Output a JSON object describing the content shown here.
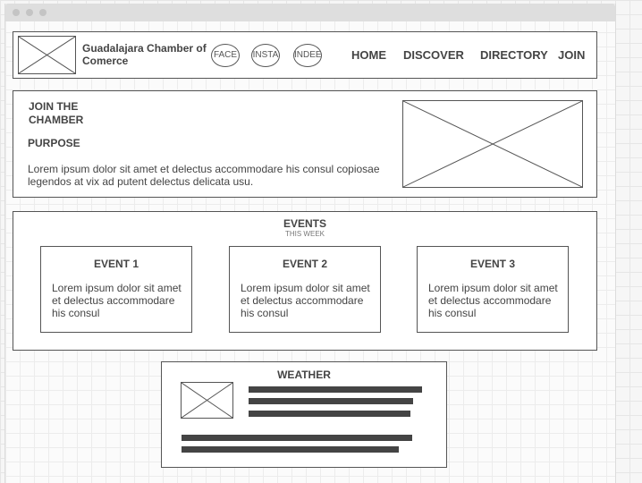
{
  "header": {
    "brand": "Guadalajara Chamber of Comerce",
    "social": [
      "FACE",
      "INSTA",
      "INDEE"
    ],
    "nav": [
      "HOME",
      "DISCOVER",
      "DIRECTORY",
      "JOIN"
    ]
  },
  "hero": {
    "title": "JOIN THE CHAMBER",
    "subtitle": "PURPOSE",
    "text": "Lorem ipsum dolor sit amet et delectus accommodare his consul copiosae legendos at vix ad putent delectus delicata usu."
  },
  "events": {
    "title": "EVENTS",
    "subtitle": "THIS WEEK",
    "items": [
      {
        "title": "EVENT 1",
        "text": "Lorem ipsum dolor sit amet et delectus accommodare his consul"
      },
      {
        "title": "EVENT 2",
        "text": "Lorem ipsum dolor sit amet et delectus accommodare his consul"
      },
      {
        "title": "EVENT 3",
        "text": "Lorem ipsum dolor sit amet et delectus accommodare his consul"
      }
    ]
  },
  "weather": {
    "title": "WEATHER"
  },
  "icons": {
    "logo": "image-placeholder-icon",
    "hero_image": "image-placeholder-icon",
    "weather_image": "image-placeholder-icon"
  }
}
